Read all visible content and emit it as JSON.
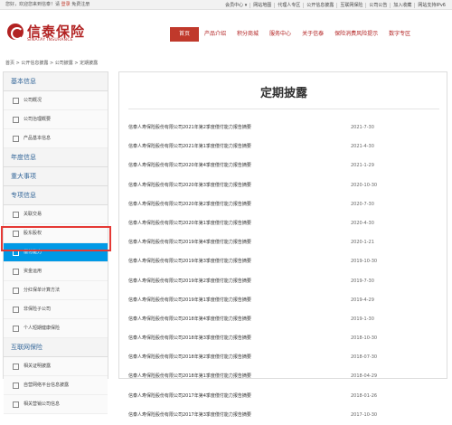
{
  "topbar": {
    "welcome": "您好，欢迎您来到信泰！请",
    "login": "登录",
    "register": "免费注册",
    "links": [
      "会员中心 ▾",
      "网站地图",
      "代理人专区",
      "公开信息披露",
      "互联网保险",
      "公司公告",
      "加入收藏",
      "网站支持IPv6"
    ]
  },
  "logo": {
    "cn": "信泰保险",
    "en": "SINATAY INSURANCE"
  },
  "nav": [
    "首页",
    "产品介绍",
    "积分商城",
    "服务中心",
    "关于信泰",
    "保险消费风险提示",
    "数字专区"
  ],
  "breadcrumb": "首页 > 公开信息披露 > 公司披露 > 定期披露",
  "sidebar": {
    "sections": [
      {
        "title": "基本信息",
        "items": [
          "公司概况",
          "公司治理概要",
          "产品基本信息"
        ]
      },
      {
        "title": "年度信息",
        "items": []
      },
      {
        "title": "重大事项",
        "items": []
      },
      {
        "title": "专项信息",
        "items": [
          "关联交易",
          "股东股权",
          "偿付能力",
          "资金运用",
          "分红保单计算方法",
          "非保险子公司",
          "个人短期健康保险"
        ]
      },
      {
        "title": "互联网保险",
        "items": [
          "相关证明披露",
          "自营网络平台信息披露",
          "相关营销公司信息"
        ]
      }
    ],
    "active_item": "偿付能力"
  },
  "main": {
    "title": "定期披露",
    "rows": [
      {
        "title": "信泰人寿保险股份有限公司2021年第2季度偿付能力报告摘要",
        "date": "2021-7-30"
      },
      {
        "title": "信泰人寿保险股份有限公司2021年第1季度偿付能力报告摘要",
        "date": "2021-4-30"
      },
      {
        "title": "信泰人寿保险股份有限公司2020年第4季度偿付能力报告摘要",
        "date": "2021-1-29"
      },
      {
        "title": "信泰人寿保险股份有限公司2020年第3季度偿付能力报告摘要",
        "date": "2020-10-30"
      },
      {
        "title": "信泰人寿保险股份有限公司2020年第2季度偿付能力报告摘要",
        "date": "2020-7-30"
      },
      {
        "title": "信泰人寿保险股份有限公司2020年第1季度偿付能力报告摘要",
        "date": "2020-4-30"
      },
      {
        "title": "信泰人寿保险股份有限公司2019年第4季度偿付能力报告摘要",
        "date": "2020-1-21"
      },
      {
        "title": "信泰人寿保险股份有限公司2019年第3季度偿付能力报告摘要",
        "date": "2019-10-30"
      },
      {
        "title": "信泰人寿保险股份有限公司2019年第2季度偿付能力报告摘要",
        "date": "2019-7-30"
      },
      {
        "title": "信泰人寿保险股份有限公司2019年第1季度偿付能力报告摘要",
        "date": "2019-4-29"
      },
      {
        "title": "信泰人寿保险股份有限公司2018年第4季度偿付能力报告摘要",
        "date": "2019-1-30"
      },
      {
        "title": "信泰人寿保险股份有限公司2018年第3季度偿付能力报告摘要",
        "date": "2018-10-30"
      },
      {
        "title": "信泰人寿保险股份有限公司2018年第2季度偿付能力报告摘要",
        "date": "2018-07-30"
      },
      {
        "title": "信泰人寿保险股份有限公司2018年第1季度偿付能力报告摘要",
        "date": "2018-04-29"
      },
      {
        "title": "信泰人寿保险股份有限公司2017年第4季度偿付能力报告摘要",
        "date": "2018-01-26"
      },
      {
        "title": "信泰人寿保险股份有限公司2017年第3季度偿付能力报告摘要",
        "date": "2017-10-30"
      }
    ]
  }
}
